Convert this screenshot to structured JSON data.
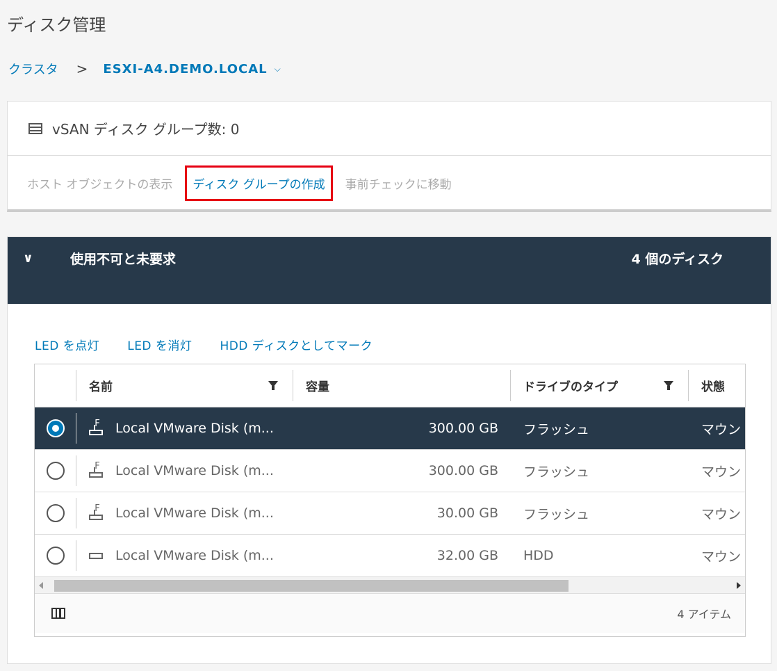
{
  "page_title": "ディスク管理",
  "breadcrumb": {
    "cluster": "クラスタ",
    "separator": ">",
    "host": "ESXI-A4.DEMO.LOCAL"
  },
  "summary": {
    "title": "vSAN ディスク グループ数: 0",
    "actions": {
      "view_host_objects": "ホスト オブジェクトの表示",
      "create_disk_group": "ディスク グループの作成",
      "go_to_precheck": "事前チェックに移動"
    }
  },
  "section": {
    "title": "使用不可と未要求",
    "disk_count": "4 個のディスク"
  },
  "toolbar": {
    "led_on": "LED を点灯",
    "led_off": "LED を消灯",
    "mark_hdd": "HDD ディスクとしてマーク"
  },
  "grid": {
    "columns": {
      "name": "名前",
      "capacity": "容量",
      "drive_type": "ドライブのタイプ",
      "state": "状態"
    },
    "rows": [
      {
        "name": "Local VMware Disk (m...",
        "capacity": "300.00 GB",
        "drive_type": "フラッシュ",
        "state": "マウン",
        "icon": "flash-disk-icon",
        "selected": true
      },
      {
        "name": "Local VMware Disk (m...",
        "capacity": "300.00 GB",
        "drive_type": "フラッシュ",
        "state": "マウン",
        "icon": "flash-disk-icon",
        "selected": false
      },
      {
        "name": "Local VMware Disk (m...",
        "capacity": "30.00 GB",
        "drive_type": "フラッシュ",
        "state": "マウン",
        "icon": "flash-disk-icon",
        "selected": false
      },
      {
        "name": "Local VMware Disk (m...",
        "capacity": "32.00 GB",
        "drive_type": "HDD",
        "state": "マウン",
        "icon": "hdd-disk-icon",
        "selected": false
      }
    ],
    "footer": {
      "item_count": "4 アイテム"
    }
  },
  "colors": {
    "accent": "#0079b8",
    "header_bg": "#27394a",
    "highlight_border": "#e60012"
  }
}
